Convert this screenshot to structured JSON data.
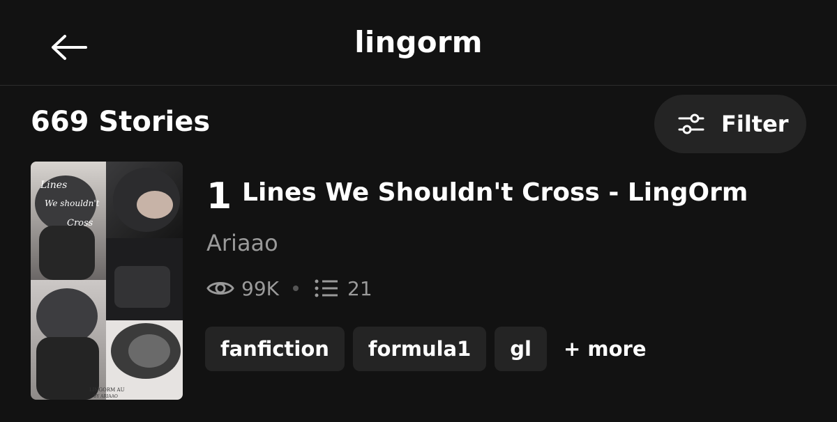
{
  "header": {
    "title": "lingorm",
    "back_icon": "arrow-left-icon"
  },
  "results": {
    "count_label": "669 Stories"
  },
  "filter": {
    "label": "Filter",
    "icon": "sliders-icon"
  },
  "story": {
    "rank": "1",
    "title": "Lines We Shouldn't Cross - LingOrm",
    "author": "Ariaao",
    "reads": "99K",
    "parts": "21",
    "tags": [
      "fanfiction",
      "formula1",
      "gl"
    ],
    "more_label": "+ more",
    "cover_text": [
      "Lines",
      "We shouldn't",
      "Cross"
    ],
    "cover_footer": "LINGORM AU",
    "cover_footer2": "BY ARIAAO"
  },
  "colors": {
    "background": "#121212",
    "surface": "#242424",
    "muted_text": "#9a9a9a"
  }
}
